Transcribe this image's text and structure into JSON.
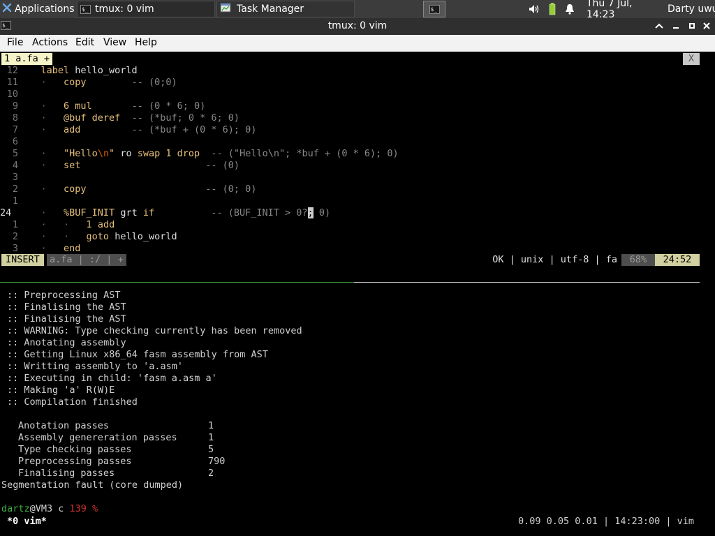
{
  "panel": {
    "apps_label": "Applications",
    "tasks": [
      {
        "label": "tmux: 0 vim"
      },
      {
        "label": "Task Manager"
      }
    ],
    "clock": "Thu  7 Jul, 14:23",
    "user": "Darty uwu"
  },
  "window": {
    "title": "tmux: 0 vim"
  },
  "menubar": {
    "items": [
      "File",
      "Actions",
      "Edit",
      "View",
      "Help"
    ]
  },
  "vim": {
    "tab_label": "1 a.fa +",
    "tab_close": "X",
    "lines": [
      {
        "n": "12",
        "text": "    label hello_world"
      },
      {
        "n": "11",
        "text": "copy        -- (0;0)"
      },
      {
        "n": "10",
        "text": ""
      },
      {
        "n": "9",
        "text": "6 mul       -- (0 * 6; 0)"
      },
      {
        "n": "8",
        "text": "@buf deref  -- (*buf; 0 * 6; 0)"
      },
      {
        "n": "7",
        "text": "add         -- (*buf + (0 * 6); 0)"
      },
      {
        "n": "6",
        "text": ""
      },
      {
        "n": "5",
        "text": "\"Hello\\n\" ro swap 1 drop  -- (\"Hello\\n\"; *buf + (0 * 6); 0)"
      },
      {
        "n": "4",
        "text": "set                      -- (0)"
      },
      {
        "n": "3",
        "text": ""
      },
      {
        "n": "2",
        "text": "copy                     -- (0; 0)"
      },
      {
        "n": "1",
        "text": ""
      },
      {
        "n": "24",
        "text": "%BUF_INIT grt if          -- (BUF_INIT > 0?; 0)"
      },
      {
        "n": "1",
        "text": "1 add"
      },
      {
        "n": "2",
        "text": "goto hello_world"
      },
      {
        "n": "3",
        "text": "end"
      }
    ],
    "status": {
      "mode": "INSERT",
      "file": "a.fa",
      "extra": " :/ ",
      "plus": "+",
      "right": "OK | unix | utf-8 | fa",
      "percent": "68%",
      "position": "24:52"
    }
  },
  "output": {
    "lines": [
      ":: Preprocessing AST",
      ":: Finalising the AST",
      ":: Finalising the AST",
      ":: WARNING: Type checking currently has been removed",
      ":: Anotating assembly",
      ":: Getting Linux x86_64 fasm assembly from AST",
      ":: Writting assembly to 'a.asm'",
      ":: Executing in child: 'fasm a.asm a'",
      ":: Making 'a' R(W)E",
      ":: Compilation finished"
    ],
    "stats": [
      {
        "label": "Anotation passes",
        "value": "1"
      },
      {
        "label": "Assembly genereration passes",
        "value": "1"
      },
      {
        "label": "Type checking passes",
        "value": "5"
      },
      {
        "label": "Preprocessing passes",
        "value": "790"
      },
      {
        "label": "Finalising passes",
        "value": "2"
      }
    ],
    "segfault": "Segmentation fault (core dumped)",
    "prompt_user": "dartz",
    "prompt_host": "@VM3 c ",
    "prompt_code": "139 %"
  },
  "tmux": {
    "window": "*0 vim*",
    "right": "0.09 0.05 0.01 | 14:23:00 | vim"
  },
  "colors": {
    "status_bg": "#c8c8c8",
    "status_mode_bg": "#d0d0a0",
    "prompt_code": "#d03030",
    "sep_green": "#3c9c3c"
  }
}
